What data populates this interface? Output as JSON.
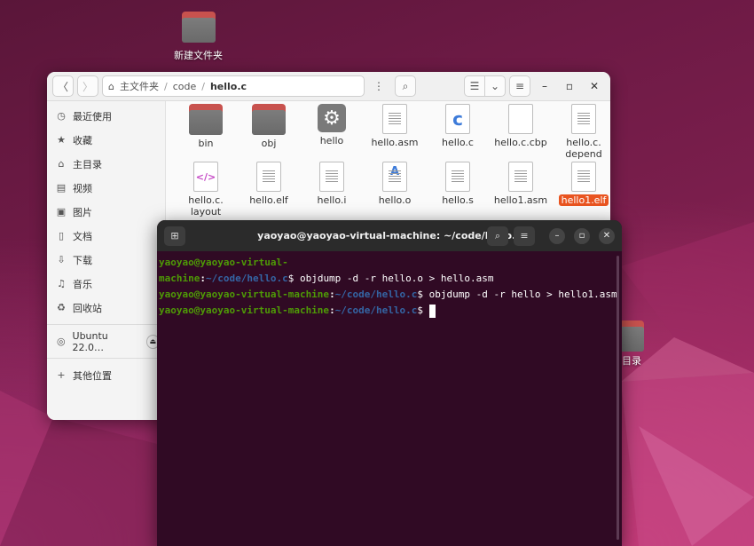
{
  "desktop": {
    "folder_label": "新建文件夹",
    "home_label": "目录"
  },
  "file_manager": {
    "path": {
      "home": "主文件夹",
      "seg1": "code",
      "current": "hello.c"
    },
    "sidebar": [
      {
        "icon": "clock-icon",
        "glyph": "◷",
        "label": "最近使用"
      },
      {
        "icon": "star-icon",
        "glyph": "★",
        "label": "收藏"
      },
      {
        "icon": "home-icon",
        "glyph": "⌂",
        "label": "主目录"
      },
      {
        "icon": "video-icon",
        "glyph": "▤",
        "label": "视频"
      },
      {
        "icon": "image-icon",
        "glyph": "▣",
        "label": "图片"
      },
      {
        "icon": "document-icon",
        "glyph": "▯",
        "label": "文档"
      },
      {
        "icon": "download-icon",
        "glyph": "⇩",
        "label": "下载"
      },
      {
        "icon": "music-icon",
        "glyph": "♫",
        "label": "音乐"
      },
      {
        "icon": "trash-icon",
        "glyph": "♻",
        "label": "回收站"
      }
    ],
    "drive_label": "Ubuntu 22.0…",
    "other_locations": "其他位置",
    "files": [
      {
        "name": "bin",
        "kind": "folder"
      },
      {
        "name": "obj",
        "kind": "folder"
      },
      {
        "name": "hello",
        "kind": "exec"
      },
      {
        "name": "hello.asm",
        "kind": "text"
      },
      {
        "name": "hello.c",
        "kind": "c"
      },
      {
        "name": "hello.c.cbp",
        "kind": "blank"
      },
      {
        "name": "hello.c.\ndepend",
        "kind": "text"
      },
      {
        "name": "hello.c.\nlayout",
        "kind": "xml"
      },
      {
        "name": "hello.elf",
        "kind": "text"
      },
      {
        "name": "hello.i",
        "kind": "text"
      },
      {
        "name": "hello.o",
        "kind": "obj"
      },
      {
        "name": "hello.s",
        "kind": "text"
      },
      {
        "name": "hello1.asm",
        "kind": "text"
      },
      {
        "name": "hello1.elf",
        "kind": "text",
        "selected": true
      }
    ]
  },
  "terminal": {
    "title": "yaoyao@yaoyao-virtual-machine: ~/code/hello.c",
    "lines": [
      {
        "user": "yaoyao@yaoyao-virtual-machine",
        "path": "~/code/hello.c",
        "cmd": "$ objdump -d -r hello.o > hello.asm"
      },
      {
        "user": "yaoyao@yaoyao-virtual-machine",
        "path": "~/code/hello.c",
        "cmd": "$ objdump -d -r hello > hello1.asm"
      },
      {
        "user": "yaoyao@yaoyao-virtual-machine",
        "path": "~/code/hello.c",
        "cmd": "$ "
      }
    ]
  }
}
